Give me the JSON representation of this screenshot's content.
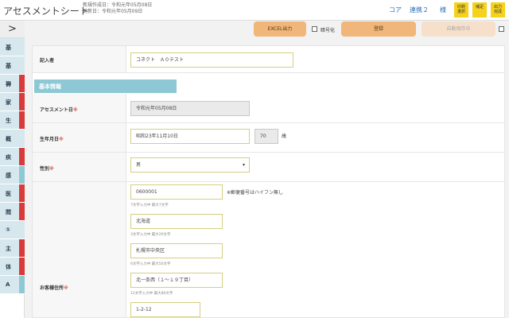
{
  "header": {
    "title": "アセスメントシート",
    "created": "新規作成日：令和元年05月08日",
    "updated": "更新日：令和元年05月09日",
    "links": [
      "コア",
      "連携２",
      "様"
    ],
    "icons": [
      "印刷\n選択",
      "補足",
      "出力\n完成"
    ]
  },
  "sidebar": {
    "toggle": ">",
    "items": [
      {
        "label": "基",
        "bar": ""
      },
      {
        "label": "基",
        "bar": ""
      },
      {
        "label": "褥",
        "bar": "#d93a3a"
      },
      {
        "label": "家",
        "bar": "#d93a3a"
      },
      {
        "label": "生",
        "bar": "#d93a3a"
      },
      {
        "label": "概",
        "bar": ""
      },
      {
        "label": "疾",
        "bar": "#d93a3a"
      },
      {
        "label": "感",
        "bar": "#8ec8d4"
      },
      {
        "label": "医",
        "bar": "#d93a3a"
      },
      {
        "label": "閲",
        "bar": "#d93a3a"
      },
      {
        "label": "①",
        "bar": ""
      },
      {
        "label": "主",
        "bar": "#d93a3a"
      },
      {
        "label": "体",
        "bar": "#d93a3a"
      },
      {
        "label": "A",
        "bar": "#8ec8d4"
      }
    ]
  },
  "toolbar": {
    "excel_label": "EXCEL出力",
    "encrypt_label": "暗号化",
    "register_label": "登録",
    "autosave_label": "自動保存中"
  },
  "form": {
    "entrant_label": "記入者",
    "entrant_value": "コネクト　Ａ０テスト",
    "section_title": "基本情報",
    "assess_date_label": "アセスメント日",
    "assess_date_value": "令和元年05月08日",
    "birth_label": "生年月日",
    "birth_value": "昭和23年11月10日",
    "age_value": "70",
    "age_unit": "歳",
    "gender_label": "性別",
    "gender_value": "男",
    "address_label": "お客様住所",
    "req_mark": "※",
    "postal_value": "0600001",
    "postal_note": "※郵便番号はハイフン無し",
    "postal_hint": "7文字入力中 最大7文字",
    "pref_value": "北海道",
    "pref_hint": "3文字入力中 最大20文字",
    "city_value": "札幌市中央区",
    "city_hint": "6文字入力中 最大50文字",
    "town_value": "北一条西（１～１９丁目）",
    "town_hint": "12文字入力中 最大80文字",
    "block_value": "1-2-12"
  },
  "colors": {
    "accent_orange": "#f0b67a",
    "section_blue": "#8ec8d4",
    "link_blue": "#2b6fb6",
    "icon_yellow": "#f5d21b",
    "required_red": "#d9534f"
  }
}
